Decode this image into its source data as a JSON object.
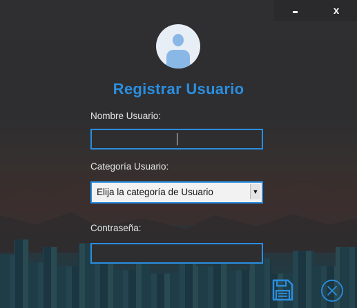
{
  "window": {
    "minimize_icon": "minimize-icon",
    "close_label": "x"
  },
  "form": {
    "title": "Registrar Usuario",
    "username_label": "Nombre Usuario:",
    "username_value": "",
    "category_label": "Categoría Usuario:",
    "category_selected": "Elija la categoría de Usuario",
    "password_label": "Contraseña:",
    "password_value": ""
  },
  "icons": {
    "avatar": "user-avatar-icon",
    "save": "save-icon",
    "cancel": "cancel-icon"
  },
  "colors": {
    "accent": "#2a8ee0",
    "background": "#2b2b2d"
  }
}
